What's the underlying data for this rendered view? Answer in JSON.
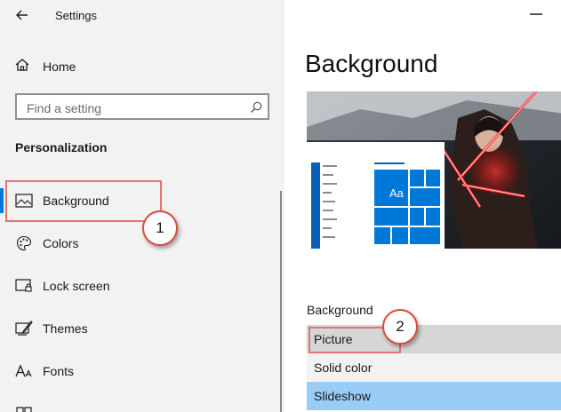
{
  "window": {
    "title": "Settings"
  },
  "sidebar": {
    "home_label": "Home",
    "search_placeholder": "Find a setting",
    "section_title": "Personalization",
    "items": [
      {
        "label": "Background",
        "icon": "picture-icon",
        "selected": true
      },
      {
        "label": "Colors",
        "icon": "palette-icon",
        "selected": false
      },
      {
        "label": "Lock screen",
        "icon": "lock-screen-icon",
        "selected": false
      },
      {
        "label": "Themes",
        "icon": "themes-icon",
        "selected": false
      },
      {
        "label": "Fonts",
        "icon": "fonts-icon",
        "selected": false
      }
    ]
  },
  "main": {
    "page_title": "Background",
    "preview": {
      "tile_label": "Aa"
    },
    "background_label": "Background",
    "dropdown_options": [
      {
        "label": "Picture",
        "state": "current"
      },
      {
        "label": "Solid color",
        "state": "normal"
      },
      {
        "label": "Slideshow",
        "state": "hover"
      }
    ]
  },
  "annotations": {
    "callout_1": "1",
    "callout_2": "2"
  },
  "colors": {
    "accent": "#0078d7",
    "sidebar_bg": "#f2f2f2",
    "annotation_red": "#d94a3a",
    "dropdown_current": "#d6d6d6",
    "dropdown_hover": "#99cdf5"
  }
}
